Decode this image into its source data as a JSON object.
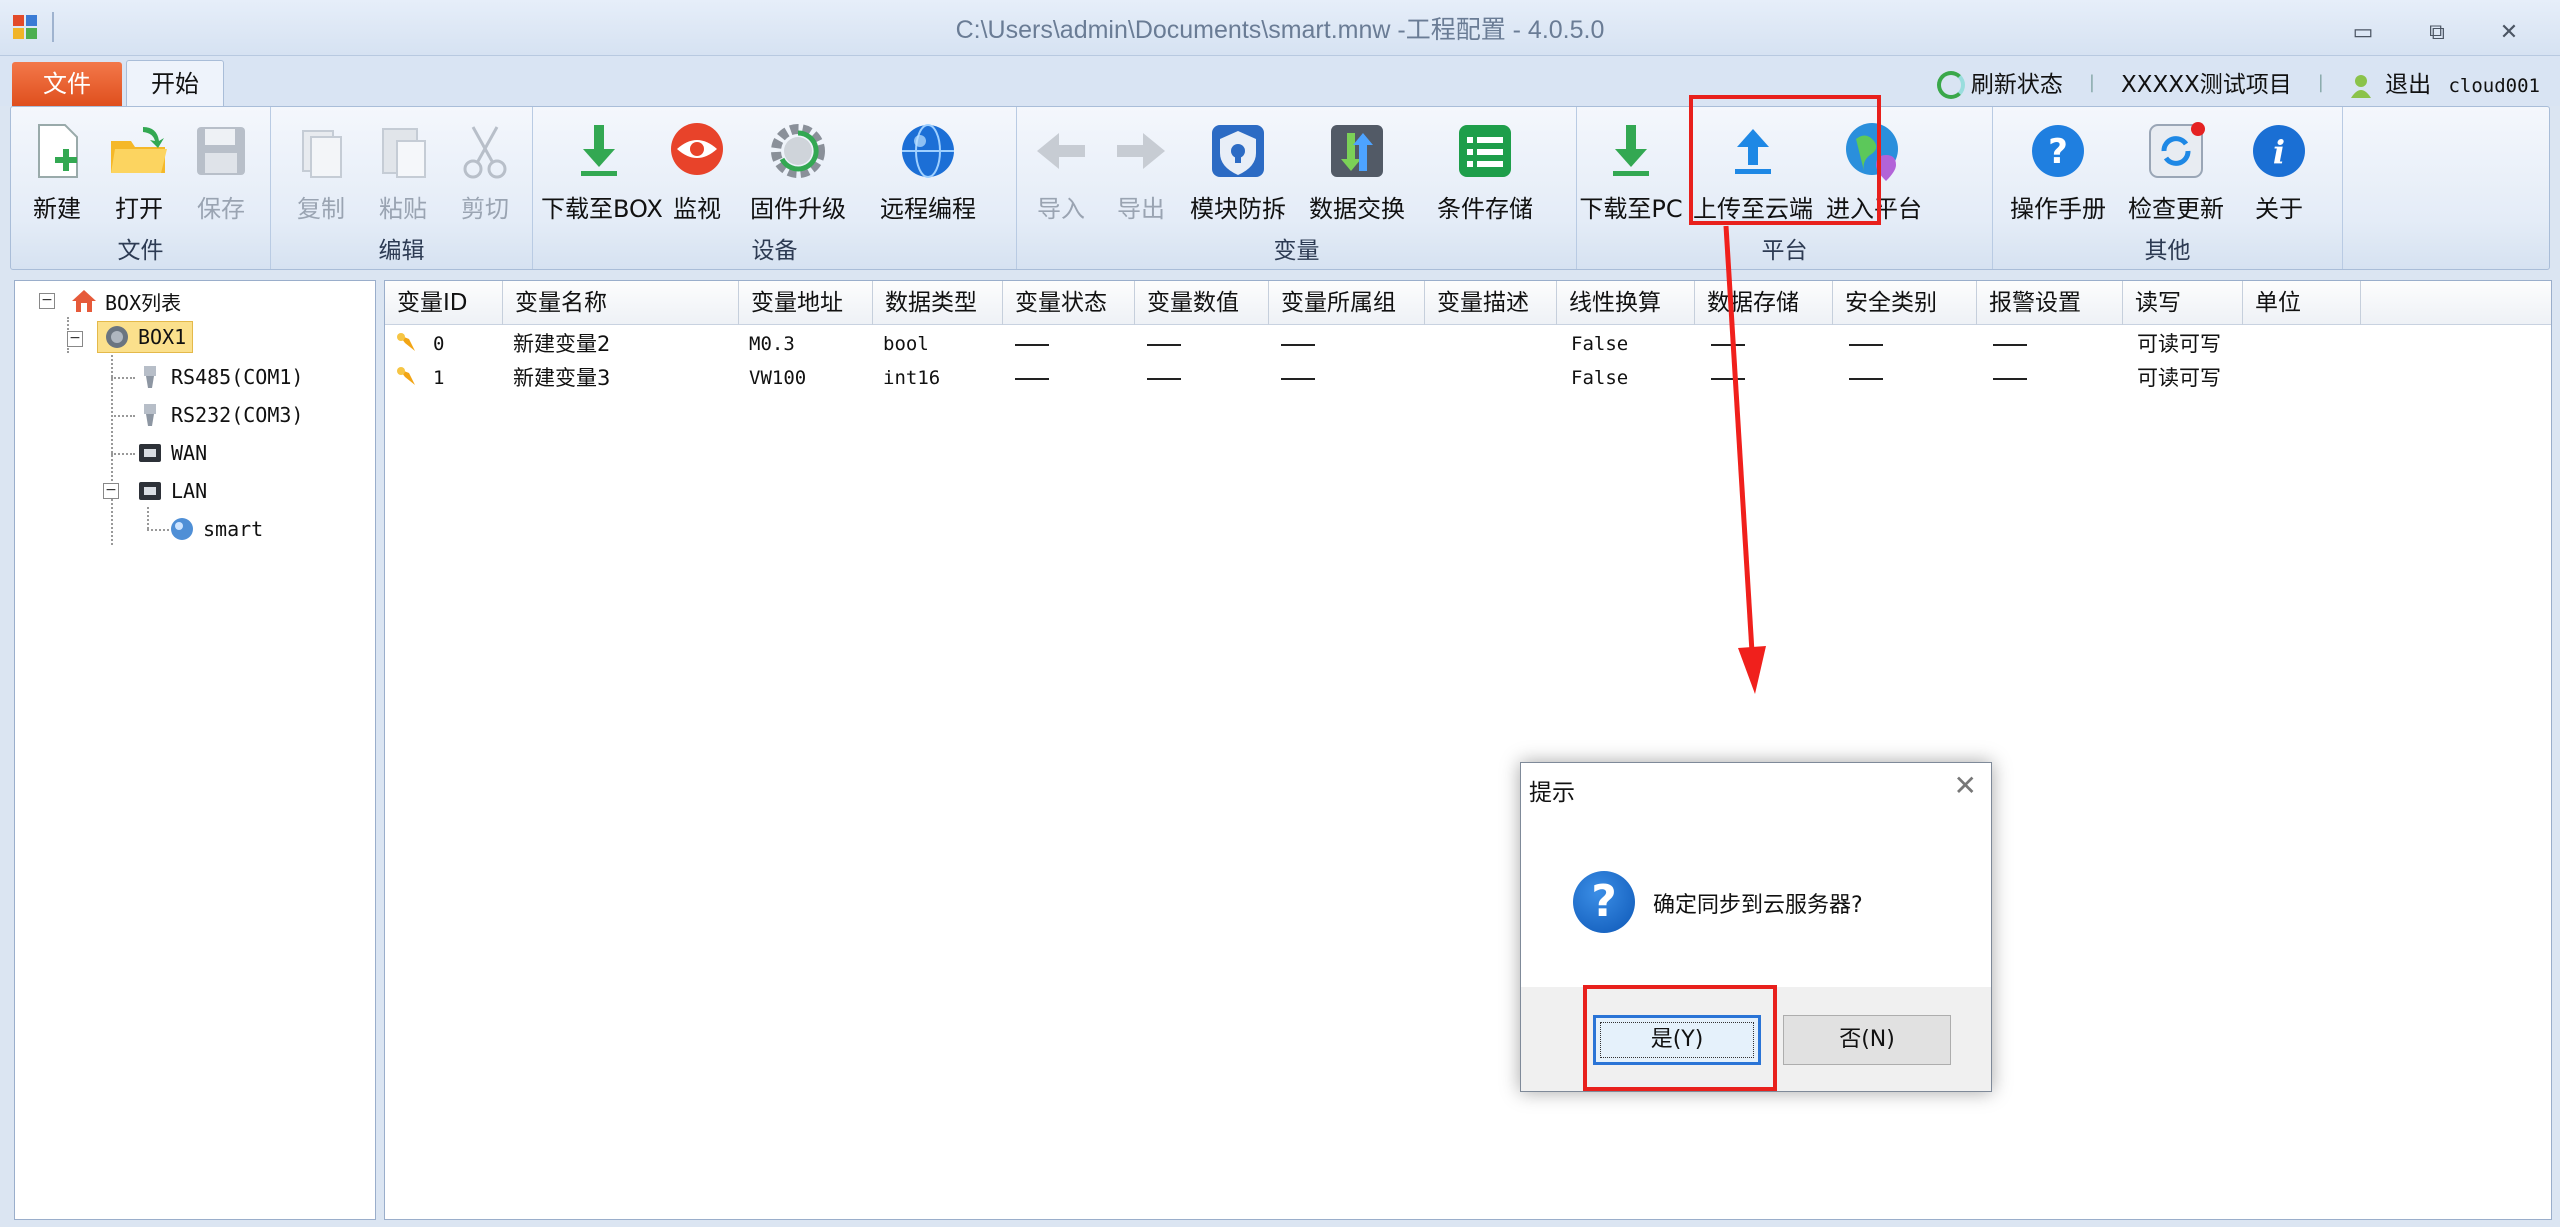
{
  "window": {
    "title": "C:\\Users\\admin\\Documents\\smart.mnw  -工程配置 - 4.0.5.0",
    "minimize": "▭",
    "restore": "⧉",
    "close": "✕"
  },
  "tabs": {
    "file": "文件",
    "start": "开始"
  },
  "header_links": {
    "refresh": "刷新状态",
    "project": "XXXXX测试项目",
    "logout": "退出",
    "user": "cloud001",
    "sep": "|"
  },
  "ribbon": {
    "groups": {
      "file": "文件",
      "edit": "编辑",
      "device": "设备",
      "variable": "变量",
      "platform": "平台",
      "other": "其他"
    },
    "buttons": {
      "new": "新建",
      "open": "打开",
      "save": "保存",
      "copy": "复制",
      "paste": "粘贴",
      "cut": "剪切",
      "download_box": "下载至BOX",
      "monitor": "监视",
      "firmware": "固件升级",
      "remote": "远程编程",
      "import": "导入",
      "export": "导出",
      "module_protect": "模块防拆",
      "data_exchange": "数据交换",
      "cond_storage": "条件存储",
      "download_pc": "下载至PC",
      "upload_cloud": "上传至云端",
      "enter_platform": "进入平台",
      "manual": "操作手册",
      "check_update": "检查更新",
      "about": "关于"
    }
  },
  "tree": {
    "root": "BOX列表",
    "box": "BOX1",
    "rs485": "RS485(COM1)",
    "rs232": "RS232(COM3)",
    "wan": "WAN",
    "lan": "LAN",
    "smart": "smart"
  },
  "table": {
    "columns": [
      "变量ID",
      "变量名称",
      "变量地址",
      "数据类型",
      "变量状态",
      "变量数值",
      "变量所属组",
      "变量描述",
      "线性换算",
      "数据存储",
      "安全类别",
      "报警设置",
      "读写",
      "单位"
    ],
    "rows": [
      {
        "id": "0",
        "name": "新建变量2",
        "address": "M0.3",
        "type": "bool",
        "linear": "False",
        "rw": "可读可写"
      },
      {
        "id": "1",
        "name": "新建变量3",
        "address": "VW100",
        "type": "int16",
        "linear": "False",
        "rw": "可读可写"
      }
    ]
  },
  "dialog": {
    "title": "提示",
    "close": "✕",
    "icon": "?",
    "message": "确定同步到云服务器?",
    "yes": "是(Y)",
    "no": "否(N)"
  }
}
